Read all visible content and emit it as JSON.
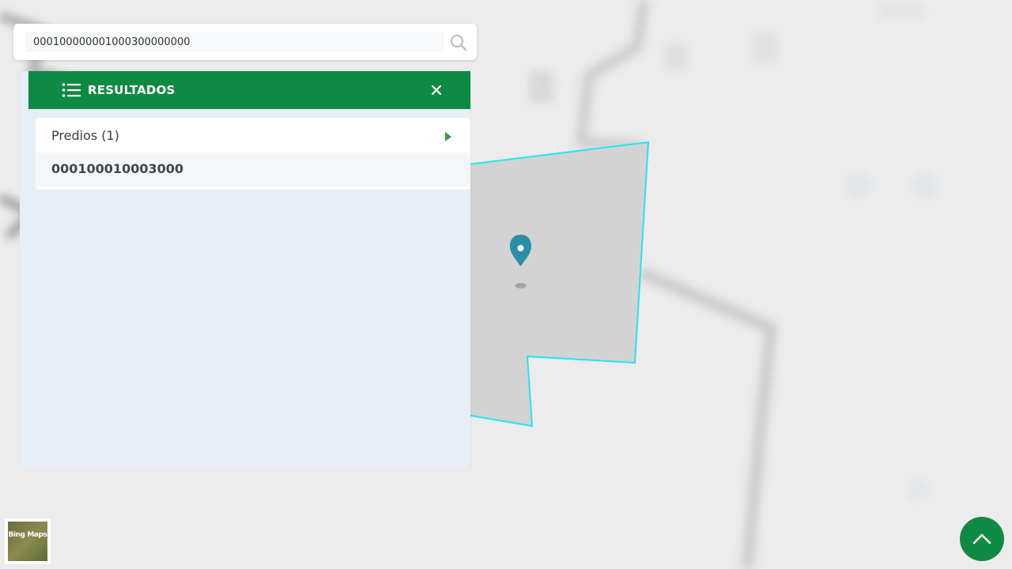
{
  "search": {
    "value": "000100000001000300000000",
    "placeholder": ""
  },
  "panel": {
    "title": "RESULTADOS",
    "group_label": "Predios (1)",
    "results": [
      "000100010003000"
    ]
  },
  "basemap": {
    "label": "Bing Maps"
  },
  "colors": {
    "brand": "#0f8a44",
    "parcel_outline": "#22e5f2",
    "marker": "#2a8fa6"
  }
}
